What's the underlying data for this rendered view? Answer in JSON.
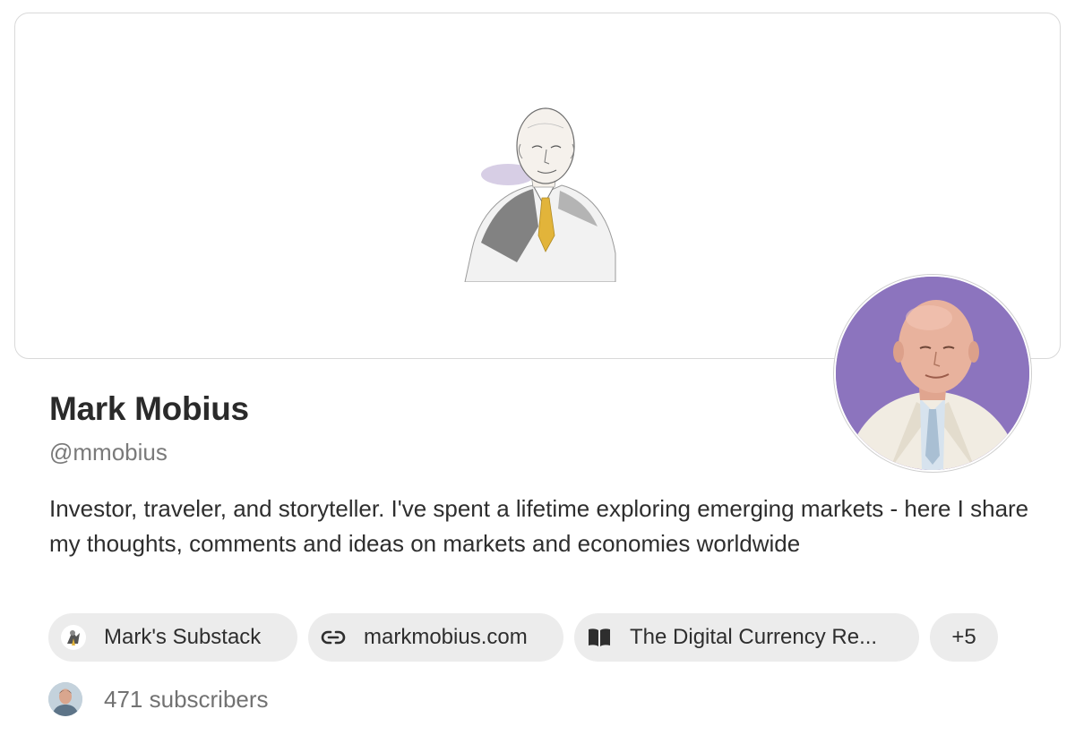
{
  "profile": {
    "name": "Mark Mobius",
    "handle": "@mmobius",
    "bio": "Investor, traveler, and storyteller. I've spent a lifetime exploring emerging markets - here I share my thoughts, comments and ideas on markets and economies worldwide"
  },
  "links": {
    "items": [
      {
        "label": "Mark's Substack",
        "icon": "substack-logo-icon"
      },
      {
        "label": "markmobius.com",
        "icon": "link-icon"
      },
      {
        "label": "The Digital Currency Re...",
        "icon": "book-icon"
      }
    ],
    "more_label": "+5"
  },
  "subscribers": {
    "text": "471 subscribers"
  },
  "colors": {
    "chip_bg": "#ececec",
    "avatar_bg": "#8c74be",
    "accent_tie": "#e2b43a"
  }
}
